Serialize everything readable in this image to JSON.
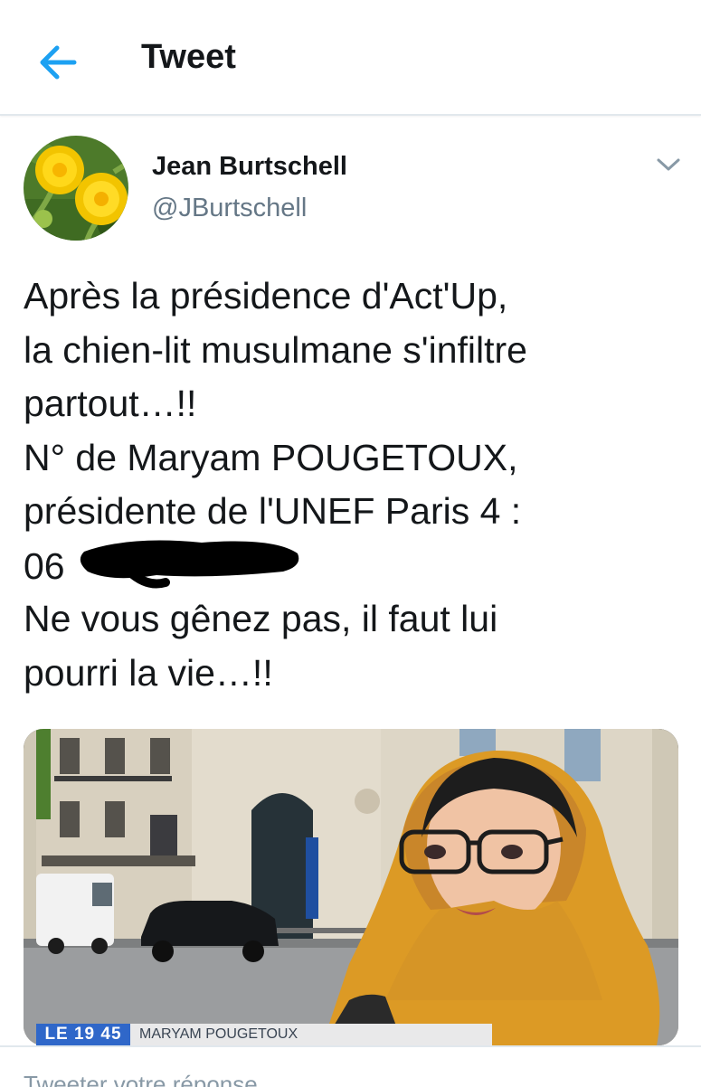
{
  "header": {
    "title": "Tweet",
    "back_icon": "arrow-left-icon"
  },
  "tweet": {
    "author": {
      "name": "Jean Burtschell",
      "handle": "@JBurtschell",
      "avatar": "dandelion-flowers-photo"
    },
    "text_lines": [
      "Après la présidence d'Act'Up,",
      "la chien-lit musulmane s'infiltre",
      "partout…!!",
      "N° de  Maryam POUGETOUX,",
      "présidente de l'UNEF Paris 4 :",
      "06",
      "Ne vous gênez pas, il faut lui",
      "pourri la vie…!!"
    ],
    "media": {
      "description_icon": "tv-news-screenshot",
      "channel_logo": "LE 19 45",
      "lower_third_name": "MARYAM POUGETOUX"
    }
  },
  "reply": {
    "placeholder": "Tweeter votre réponse"
  },
  "colors": {
    "accent": "#1da1f2",
    "text": "#14171a",
    "secondary": "#657786",
    "border": "#e1e8ed"
  }
}
